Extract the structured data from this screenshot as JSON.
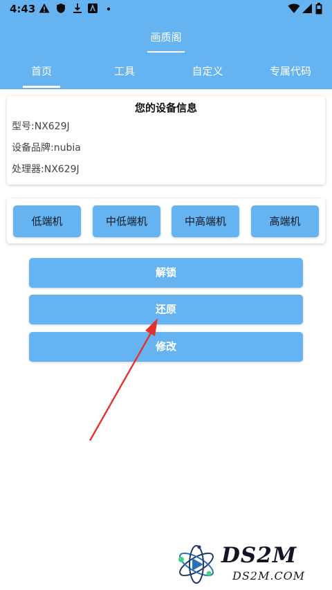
{
  "status_bar": {
    "time": "4:43"
  },
  "app": {
    "title": "画质阁"
  },
  "tabs": [
    {
      "label": "首页"
    },
    {
      "label": "工具"
    },
    {
      "label": "自定义"
    },
    {
      "label": "专属代码"
    }
  ],
  "device_info": {
    "title": "您的设备信息",
    "model": "型号:NX629J",
    "brand": "设备品牌:nubia",
    "processor": "处理器:NX629J"
  },
  "tiers": [
    {
      "label": "低端机"
    },
    {
      "label": "中低端机"
    },
    {
      "label": "中高端机"
    },
    {
      "label": "高端机"
    }
  ],
  "actions": {
    "unlock": "解锁",
    "restore": "还原",
    "modify": "修改"
  },
  "watermark": {
    "name": "DS2M",
    "domain": "DS2M.COM"
  },
  "colors": {
    "primary": "#65b3f0",
    "arrow": "#e53030"
  }
}
